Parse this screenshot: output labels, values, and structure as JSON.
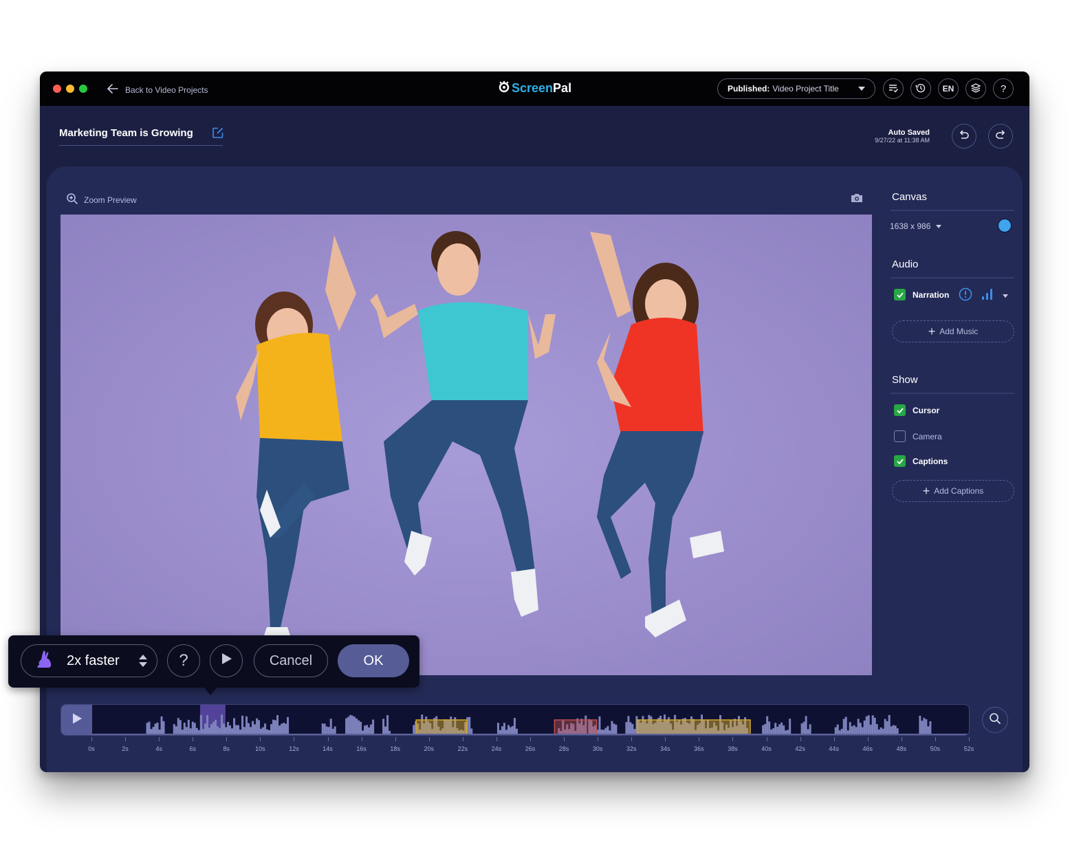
{
  "titlebar": {
    "back_label": "Back to Video Projects",
    "logo_part1": "Screen",
    "logo_part2": "Pal",
    "publish_prefix": "Published:",
    "publish_value": "Video Project Title",
    "icons": [
      "checklist-icon",
      "history-icon",
      "language-icon",
      "layers-icon",
      "help-icon"
    ],
    "language": "EN",
    "help": "?"
  },
  "project": {
    "title": "Marketing Team is Growing",
    "autosave_label": "Auto Saved",
    "autosave_time": "9/27/22 at 11:38 AM"
  },
  "preview": {
    "zoom_label": "Zoom Preview",
    "image_description": "Three people jumping joyfully against a purple background"
  },
  "sidebar": {
    "canvas_heading": "Canvas",
    "canvas_size": "1638 x 986",
    "canvas_color": "#3fa3ee",
    "audio_heading": "Audio",
    "narration_label": "Narration",
    "narration_checked": true,
    "add_music_label": "Add Music",
    "show_heading": "Show",
    "show_items": [
      {
        "label": "Cursor",
        "checked": true
      },
      {
        "label": "Camera",
        "checked": false
      },
      {
        "label": "Captions",
        "checked": true
      }
    ],
    "add_captions_label": "Add Captions"
  },
  "speed_popup": {
    "speed_label": "2x faster",
    "help": "?",
    "cancel_label": "Cancel",
    "ok_label": "OK"
  },
  "timeline": {
    "duration_s": 52,
    "tick_labels": [
      "0s",
      "2s",
      "4s",
      "6s",
      "8s",
      "10s",
      "12s",
      "14s",
      "16s",
      "18s",
      "20s",
      "22s",
      "24s",
      "26s",
      "28s",
      "30s",
      "32s",
      "34s",
      "36s",
      "38s",
      "40s",
      "42s",
      "44s",
      "46s",
      "48s",
      "50s",
      "52s"
    ],
    "selected_segment": {
      "start_s": 6.4,
      "end_s": 7.9,
      "color": "#8a6cf0"
    },
    "segments": [
      {
        "type": "speed",
        "start_s": 19.2,
        "end_s": 22.2,
        "color": "#d4a82a"
      },
      {
        "type": "cut",
        "start_s": 27.4,
        "end_s": 29.9,
        "color": "#c0504d"
      },
      {
        "type": "speed",
        "start_s": 32.3,
        "end_s": 39.0,
        "color": "#d4a82a"
      }
    ],
    "audio_clusters": [
      [
        3.2,
        4.2
      ],
      [
        4.8,
        6.4
      ],
      [
        6.4,
        11.6
      ],
      [
        13.6,
        14.4
      ],
      [
        15.0,
        16.7
      ],
      [
        17.2,
        17.6
      ],
      [
        19.0,
        22.5
      ],
      [
        24.0,
        25.2
      ],
      [
        27.6,
        29.2
      ],
      [
        29.4,
        31.1
      ],
      [
        31.6,
        33.5
      ],
      [
        33.5,
        38.8
      ],
      [
        39.7,
        41.3
      ],
      [
        42.0,
        42.6
      ],
      [
        44.0,
        47.7
      ],
      [
        49.0,
        49.7
      ]
    ]
  }
}
